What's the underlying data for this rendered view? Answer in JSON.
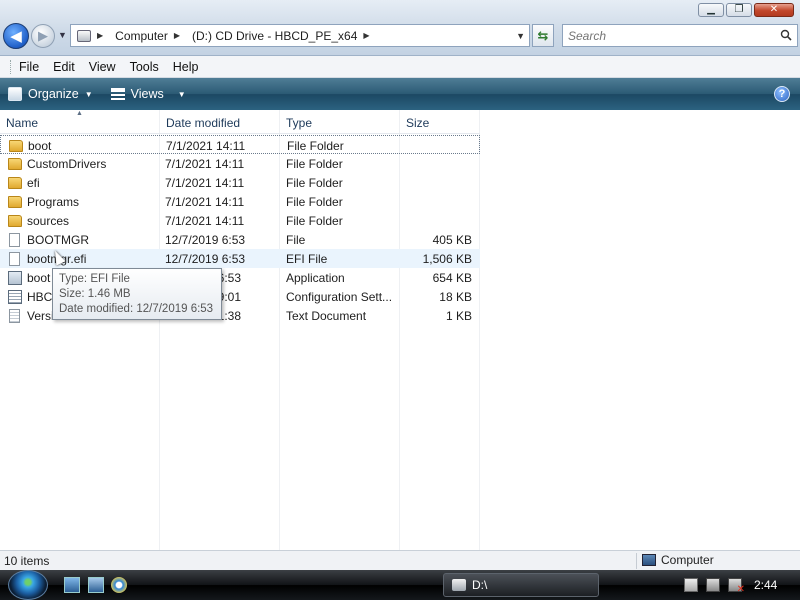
{
  "window": {
    "buttons": {
      "minimize": "▁",
      "maximize": "❐",
      "close": "✕"
    }
  },
  "address": {
    "crumbs": [
      "Computer",
      "(D:) CD Drive - HBCD_PE_x64"
    ],
    "search_placeholder": "Search"
  },
  "menu": [
    "File",
    "Edit",
    "View",
    "Tools",
    "Help"
  ],
  "toolbar": {
    "organize": "Organize",
    "views": "Views",
    "help": "?"
  },
  "columns": {
    "name": "Name",
    "date": "Date modified",
    "type": "Type",
    "size": "Size"
  },
  "rows": [
    {
      "name": "boot",
      "date": "7/1/2021 14:11",
      "type": "File Folder",
      "size": "",
      "icon": "folder-icon"
    },
    {
      "name": "CustomDrivers",
      "date": "7/1/2021 14:11",
      "type": "File Folder",
      "size": "",
      "icon": "folder-icon"
    },
    {
      "name": "efi",
      "date": "7/1/2021 14:11",
      "type": "File Folder",
      "size": "",
      "icon": "folder-icon"
    },
    {
      "name": "Programs",
      "date": "7/1/2021 14:11",
      "type": "File Folder",
      "size": "",
      "icon": "folder-icon"
    },
    {
      "name": "sources",
      "date": "7/1/2021 14:11",
      "type": "File Folder",
      "size": "",
      "icon": "folder-icon"
    },
    {
      "name": "BOOTMGR",
      "date": "12/7/2019 6:53",
      "type": "File",
      "size": "405 KB",
      "icon": "file-icon"
    },
    {
      "name": "bootmgr.efi",
      "date": "12/7/2019 6:53",
      "type": "EFI File",
      "size": "1,506 KB",
      "icon": "file-icon"
    },
    {
      "name": "boot",
      "date": "6:53",
      "type": "Application",
      "size": "654 KB",
      "icon": "application-icon"
    },
    {
      "name": "HBCD",
      "date": "9:01",
      "type": "Configuration Sett...",
      "size": "18 KB",
      "icon": "config-icon"
    },
    {
      "name": "Versi",
      "date": "1:38",
      "type": "Text Document",
      "size": "1 KB",
      "icon": "text-document-icon"
    }
  ],
  "tooltip": {
    "type": "Type: EFI File",
    "size": "Size: 1.46 MB",
    "date": "Date modified: 12/7/2019 6:53"
  },
  "status": {
    "items": "10 items",
    "location": "Computer"
  },
  "taskbar": {
    "task": "D:\\",
    "clock": "2:44"
  }
}
